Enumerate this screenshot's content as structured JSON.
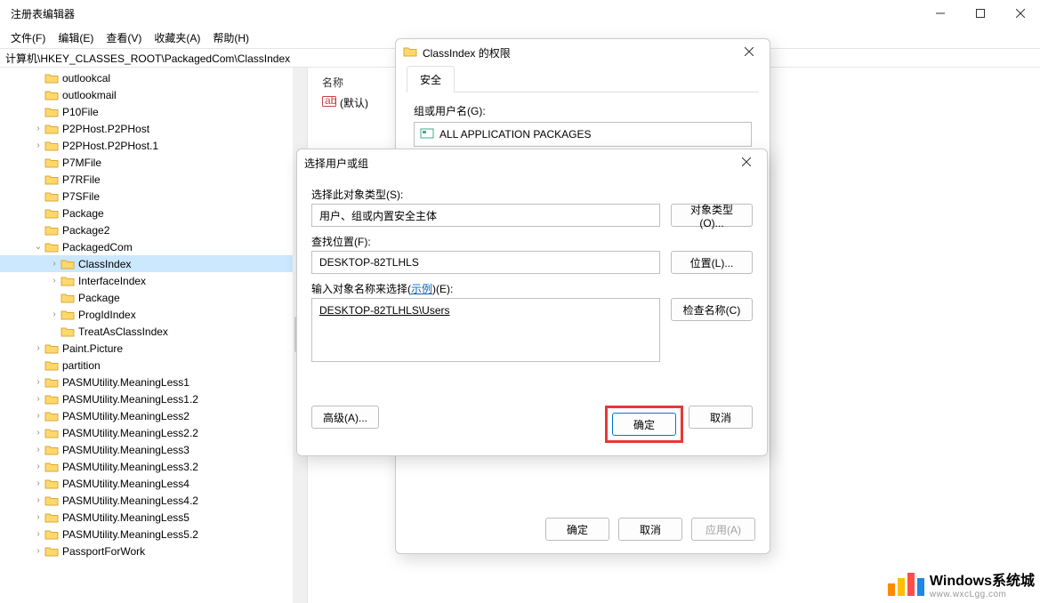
{
  "window": {
    "title": "注册表编辑器",
    "address": "计算机\\HKEY_CLASSES_ROOT\\PackagedCom\\ClassIndex"
  },
  "menu": {
    "file": "文件(F)",
    "edit": "编辑(E)",
    "view": "查看(V)",
    "fav": "收藏夹(A)",
    "help": "帮助(H)"
  },
  "tree_items": [
    {
      "depth": 2,
      "exp": "",
      "label": "outlookcal"
    },
    {
      "depth": 2,
      "exp": "",
      "label": "outlookmail"
    },
    {
      "depth": 2,
      "exp": "",
      "label": "P10File"
    },
    {
      "depth": 2,
      "exp": ">",
      "label": "P2PHost.P2PHost"
    },
    {
      "depth": 2,
      "exp": ">",
      "label": "P2PHost.P2PHost.1"
    },
    {
      "depth": 2,
      "exp": "",
      "label": "P7MFile"
    },
    {
      "depth": 2,
      "exp": "",
      "label": "P7RFile"
    },
    {
      "depth": 2,
      "exp": "",
      "label": "P7SFile"
    },
    {
      "depth": 2,
      "exp": "",
      "label": "Package"
    },
    {
      "depth": 2,
      "exp": "",
      "label": "Package2"
    },
    {
      "depth": 2,
      "exp": "v",
      "label": "PackagedCom"
    },
    {
      "depth": 3,
      "exp": ">",
      "label": "ClassIndex",
      "selected": true
    },
    {
      "depth": 3,
      "exp": ">",
      "label": "InterfaceIndex"
    },
    {
      "depth": 3,
      "exp": "",
      "label": "Package"
    },
    {
      "depth": 3,
      "exp": ">",
      "label": "ProgIdIndex"
    },
    {
      "depth": 3,
      "exp": "",
      "label": "TreatAsClassIndex"
    },
    {
      "depth": 2,
      "exp": ">",
      "label": "Paint.Picture"
    },
    {
      "depth": 2,
      "exp": "",
      "label": "partition"
    },
    {
      "depth": 2,
      "exp": ">",
      "label": "PASMUtility.MeaningLess1"
    },
    {
      "depth": 2,
      "exp": ">",
      "label": "PASMUtility.MeaningLess1.2"
    },
    {
      "depth": 2,
      "exp": ">",
      "label": "PASMUtility.MeaningLess2"
    },
    {
      "depth": 2,
      "exp": ">",
      "label": "PASMUtility.MeaningLess2.2"
    },
    {
      "depth": 2,
      "exp": ">",
      "label": "PASMUtility.MeaningLess3"
    },
    {
      "depth": 2,
      "exp": ">",
      "label": "PASMUtility.MeaningLess3.2"
    },
    {
      "depth": 2,
      "exp": ">",
      "label": "PASMUtility.MeaningLess4"
    },
    {
      "depth": 2,
      "exp": ">",
      "label": "PASMUtility.MeaningLess4.2"
    },
    {
      "depth": 2,
      "exp": ">",
      "label": "PASMUtility.MeaningLess5"
    },
    {
      "depth": 2,
      "exp": ">",
      "label": "PASMUtility.MeaningLess5.2"
    },
    {
      "depth": 2,
      "exp": ">",
      "label": "PassportForWork"
    }
  ],
  "list": {
    "header_name": "名称",
    "default_value": "(默认)"
  },
  "perm_dialog": {
    "title": "ClassIndex 的权限",
    "tab_security": "安全",
    "group_label": "组或用户名(G):",
    "group_item": "ALL APPLICATION PACKAGES",
    "ok": "确定",
    "cancel": "取消",
    "apply": "应用(A)"
  },
  "select_dialog": {
    "title": "选择用户或组",
    "obj_type_label": "选择此对象类型(S):",
    "obj_type_value": "用户、组或内置安全主体",
    "obj_type_btn": "对象类型(O)...",
    "loc_label": "查找位置(F):",
    "loc_value": "DESKTOP-82TLHLS",
    "loc_btn": "位置(L)...",
    "names_label_a": "输入对象名称来选择(",
    "names_label_link": "示例",
    "names_label_b": ")(E):",
    "names_value": "DESKTOP-82TLHLS\\Users",
    "check_btn": "检查名称(C)",
    "advanced": "高级(A)...",
    "ok": "确定",
    "cancel": "取消"
  },
  "watermark": {
    "brand": "Windows系统城",
    "url": "www.wxcLgg.com"
  }
}
